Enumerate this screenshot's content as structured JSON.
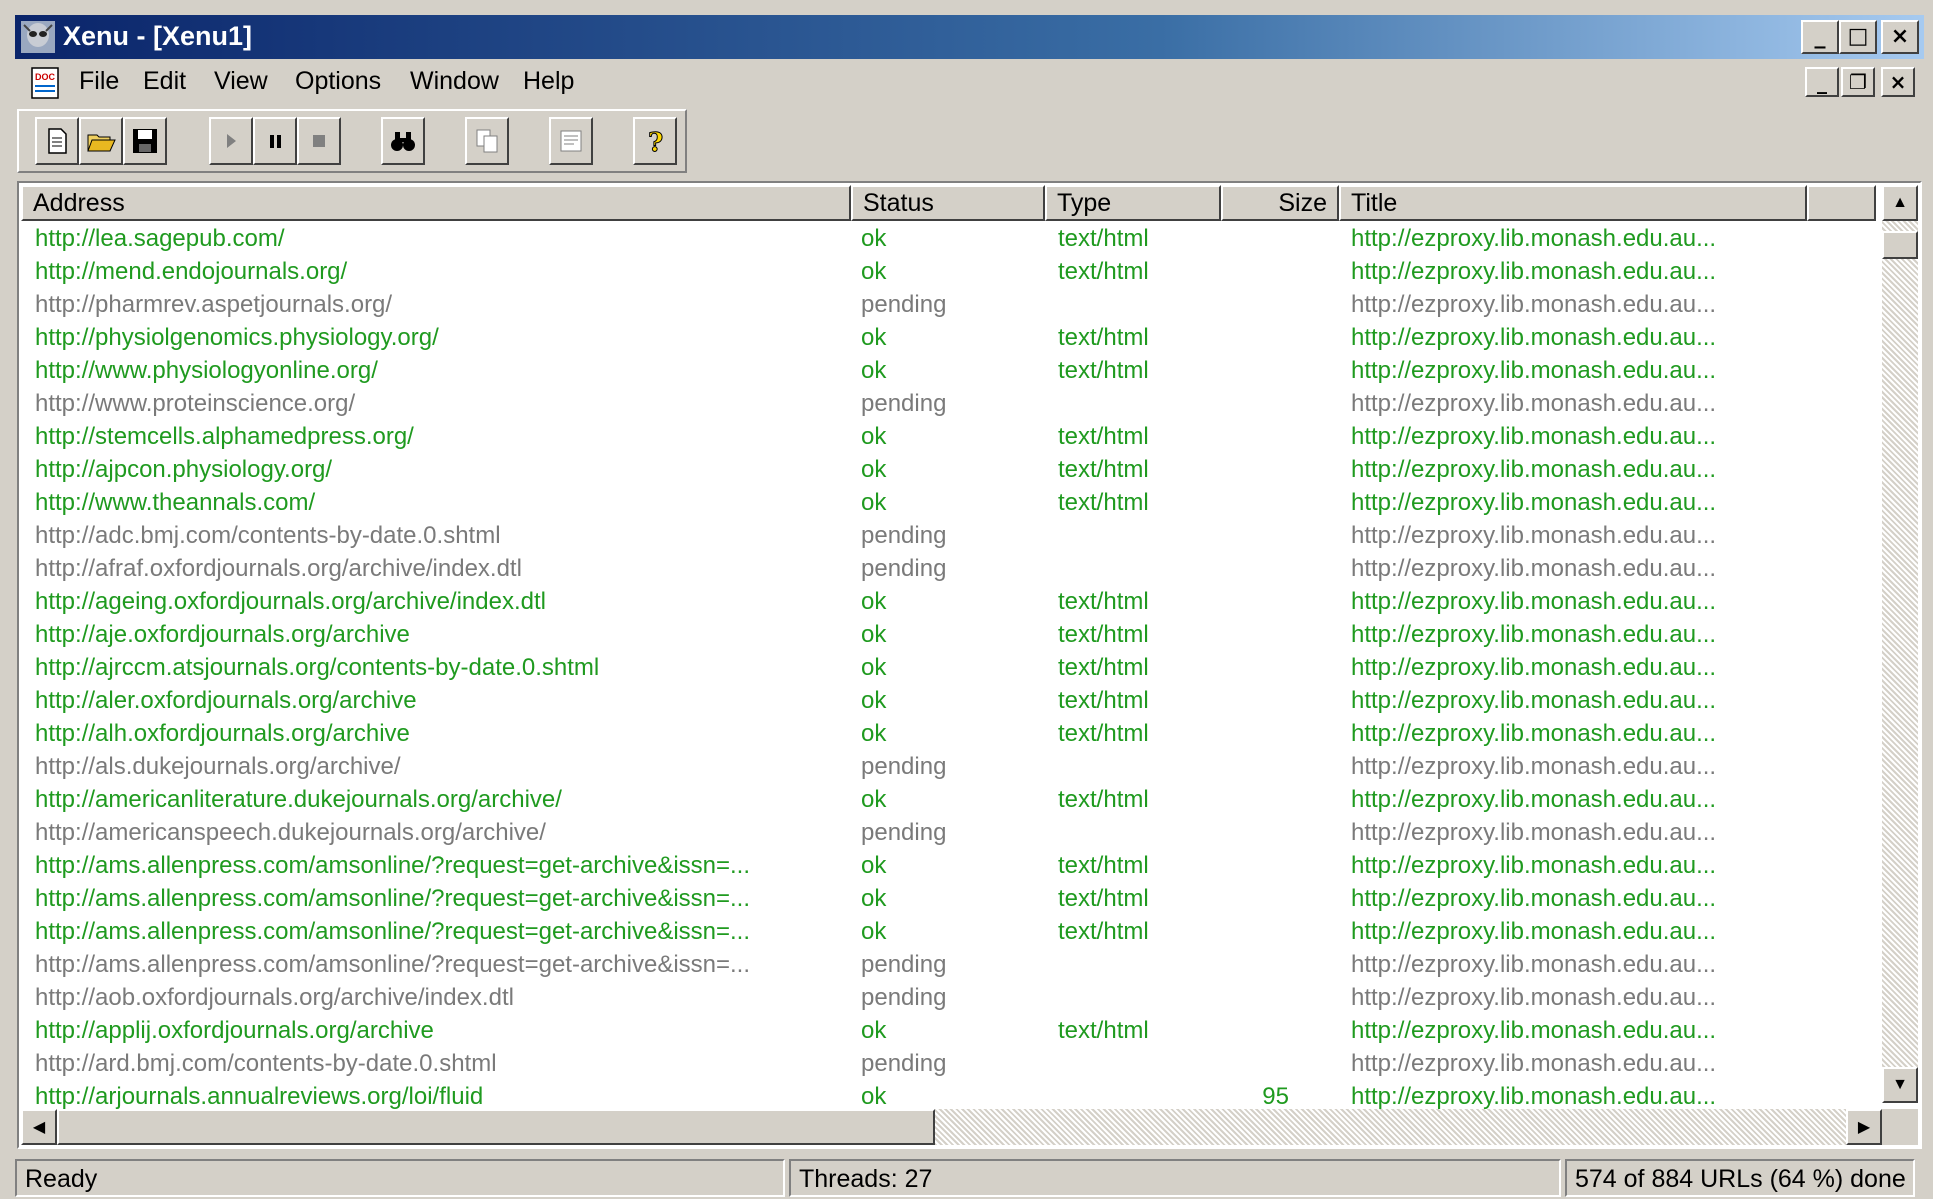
{
  "window": {
    "title": "Xenu - [Xenu1]",
    "controls": [
      "_",
      "□",
      "×"
    ]
  },
  "menu": {
    "items": [
      {
        "label": "File"
      },
      {
        "label": "Edit"
      },
      {
        "label": "View"
      },
      {
        "label": "Options"
      },
      {
        "label": "Window"
      },
      {
        "label": "Help"
      }
    ]
  },
  "toolbar": {
    "buttons": [
      "new-icon",
      "open-icon",
      "save-icon",
      "play-icon",
      "pause-icon",
      "stop-icon",
      "find-icon",
      "copy-icon",
      "properties-icon",
      "help-icon"
    ]
  },
  "table": {
    "columns": {
      "address": "Address",
      "status": "Status",
      "type": "Type",
      "size": "Size",
      "title": "Title"
    },
    "rows": [
      {
        "address": "http://lea.sagepub.com/",
        "status": "ok",
        "type": "text/html",
        "size": "",
        "title": "http://ezproxy.lib.monash.edu.au..."
      },
      {
        "address": "http://mend.endojournals.org/",
        "status": "ok",
        "type": "text/html",
        "size": "",
        "title": "http://ezproxy.lib.monash.edu.au..."
      },
      {
        "address": "http://pharmrev.aspetjournals.org/",
        "status": "pending",
        "type": "",
        "size": "",
        "title": "http://ezproxy.lib.monash.edu.au..."
      },
      {
        "address": "http://physiolgenomics.physiology.org/",
        "status": "ok",
        "type": "text/html",
        "size": "",
        "title": "http://ezproxy.lib.monash.edu.au..."
      },
      {
        "address": "http://www.physiologyonline.org/",
        "status": "ok",
        "type": "text/html",
        "size": "",
        "title": "http://ezproxy.lib.monash.edu.au..."
      },
      {
        "address": "http://www.proteinscience.org/",
        "status": "pending",
        "type": "",
        "size": "",
        "title": "http://ezproxy.lib.monash.edu.au..."
      },
      {
        "address": "http://stemcells.alphamedpress.org/",
        "status": "ok",
        "type": "text/html",
        "size": "",
        "title": "http://ezproxy.lib.monash.edu.au..."
      },
      {
        "address": "http://ajpcon.physiology.org/",
        "status": "ok",
        "type": "text/html",
        "size": "",
        "title": "http://ezproxy.lib.monash.edu.au..."
      },
      {
        "address": "http://www.theannals.com/",
        "status": "ok",
        "type": "text/html",
        "size": "",
        "title": "http://ezproxy.lib.monash.edu.au..."
      },
      {
        "address": "http://adc.bmj.com/contents-by-date.0.shtml",
        "status": "pending",
        "type": "",
        "size": "",
        "title": "http://ezproxy.lib.monash.edu.au..."
      },
      {
        "address": "http://afraf.oxfordjournals.org/archive/index.dtl",
        "status": "pending",
        "type": "",
        "size": "",
        "title": "http://ezproxy.lib.monash.edu.au..."
      },
      {
        "address": "http://ageing.oxfordjournals.org/archive/index.dtl",
        "status": "ok",
        "type": "text/html",
        "size": "",
        "title": "http://ezproxy.lib.monash.edu.au..."
      },
      {
        "address": "http://aje.oxfordjournals.org/archive",
        "status": "ok",
        "type": "text/html",
        "size": "",
        "title": "http://ezproxy.lib.monash.edu.au..."
      },
      {
        "address": "http://ajrccm.atsjournals.org/contents-by-date.0.shtml",
        "status": "ok",
        "type": "text/html",
        "size": "",
        "title": "http://ezproxy.lib.monash.edu.au..."
      },
      {
        "address": "http://aler.oxfordjournals.org/archive",
        "status": "ok",
        "type": "text/html",
        "size": "",
        "title": "http://ezproxy.lib.monash.edu.au..."
      },
      {
        "address": "http://alh.oxfordjournals.org/archive",
        "status": "ok",
        "type": "text/html",
        "size": "",
        "title": "http://ezproxy.lib.monash.edu.au..."
      },
      {
        "address": "http://als.dukejournals.org/archive/",
        "status": "pending",
        "type": "",
        "size": "",
        "title": "http://ezproxy.lib.monash.edu.au..."
      },
      {
        "address": "http://americanliterature.dukejournals.org/archive/",
        "status": "ok",
        "type": "text/html",
        "size": "",
        "title": "http://ezproxy.lib.monash.edu.au..."
      },
      {
        "address": "http://americanspeech.dukejournals.org/archive/",
        "status": "pending",
        "type": "",
        "size": "",
        "title": "http://ezproxy.lib.monash.edu.au..."
      },
      {
        "address": "http://ams.allenpress.com/amsonline/?request=get-archive&issn=...",
        "status": "ok",
        "type": "text/html",
        "size": "",
        "title": "http://ezproxy.lib.monash.edu.au..."
      },
      {
        "address": "http://ams.allenpress.com/amsonline/?request=get-archive&issn=...",
        "status": "ok",
        "type": "text/html",
        "size": "",
        "title": "http://ezproxy.lib.monash.edu.au..."
      },
      {
        "address": "http://ams.allenpress.com/amsonline/?request=get-archive&issn=...",
        "status": "ok",
        "type": "text/html",
        "size": "",
        "title": "http://ezproxy.lib.monash.edu.au..."
      },
      {
        "address": "http://ams.allenpress.com/amsonline/?request=get-archive&issn=...",
        "status": "pending",
        "type": "",
        "size": "",
        "title": "http://ezproxy.lib.monash.edu.au..."
      },
      {
        "address": "http://aob.oxfordjournals.org/archive/index.dtl",
        "status": "pending",
        "type": "",
        "size": "",
        "title": "http://ezproxy.lib.monash.edu.au..."
      },
      {
        "address": "http://applij.oxfordjournals.org/archive",
        "status": "ok",
        "type": "text/html",
        "size": "",
        "title": "http://ezproxy.lib.monash.edu.au..."
      },
      {
        "address": "http://ard.bmj.com/contents-by-date.0.shtml",
        "status": "pending",
        "type": "",
        "size": "",
        "title": "http://ezproxy.lib.monash.edu.au..."
      },
      {
        "address": "http://arjournals.annualreviews.org/loi/fluid",
        "status": "ok",
        "type": "",
        "size": "95",
        "title": "http://ezproxy.lib.monash.edu.au..."
      }
    ]
  },
  "status": {
    "ready": "Ready",
    "threads": "Threads: 27",
    "progress": "574 of 884 URLs (64 %) done"
  },
  "colors": {
    "ok": "#1f9a1f",
    "pending": "#7a7a7a"
  }
}
